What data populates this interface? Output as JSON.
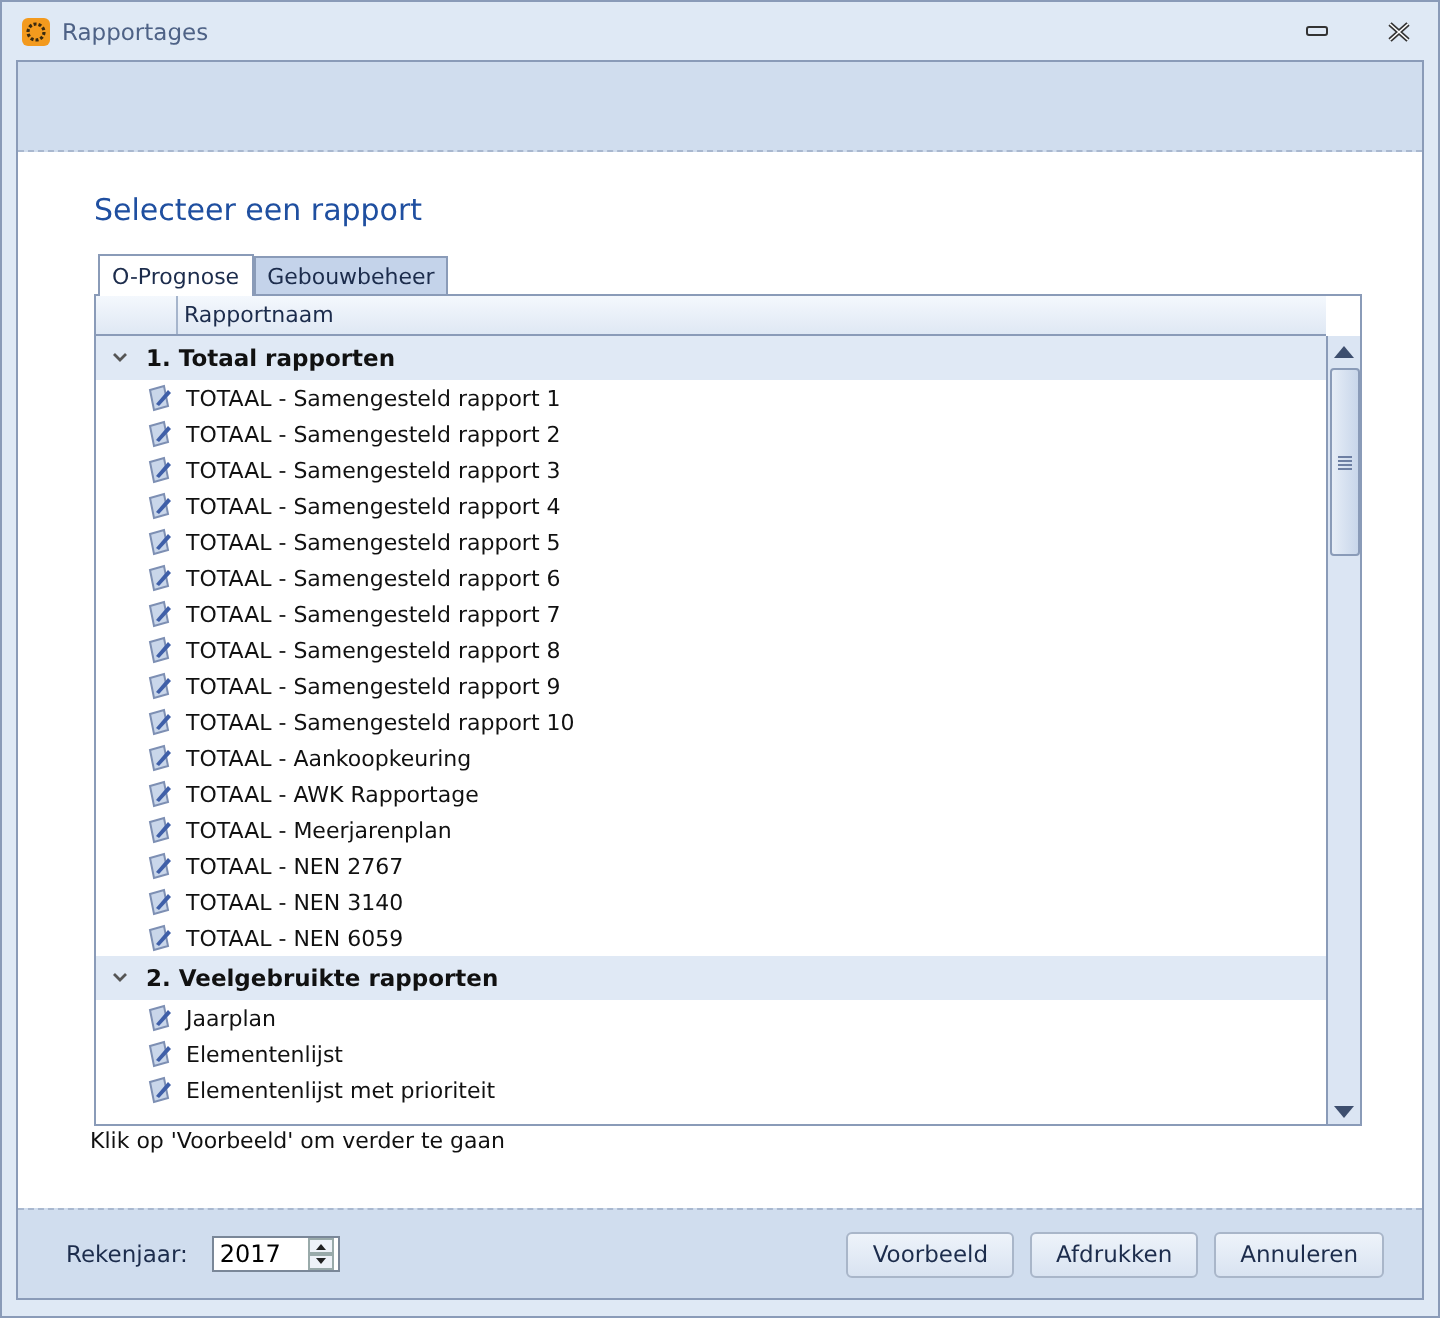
{
  "window": {
    "title": "Rapportages"
  },
  "heading": "Selecteer een rapport",
  "tabs": [
    {
      "label": "O-Prognose",
      "selected": true
    },
    {
      "label": "Gebouwbeheer",
      "selected": false
    }
  ],
  "table": {
    "columns": [
      "Rapportnaam"
    ],
    "groups": [
      {
        "label": "1. Totaal rapporten",
        "expanded": true,
        "children": [
          "TOTAAL - Samengesteld rapport 1",
          "TOTAAL - Samengesteld rapport 2",
          "TOTAAL - Samengesteld rapport 3",
          "TOTAAL - Samengesteld rapport 4",
          "TOTAAL - Samengesteld rapport 5",
          "TOTAAL - Samengesteld rapport 6",
          "TOTAAL - Samengesteld rapport 7",
          "TOTAAL - Samengesteld rapport 8",
          "TOTAAL - Samengesteld rapport 9",
          "TOTAAL - Samengesteld rapport 10",
          "TOTAAL - Aankoopkeuring",
          "TOTAAL - AWK Rapportage",
          "TOTAAL - Meerjarenplan",
          "TOTAAL - NEN 2767",
          "TOTAAL - NEN 3140",
          "TOTAAL - NEN 6059"
        ]
      },
      {
        "label": "2. Veelgebruikte rapporten",
        "expanded": true,
        "children": [
          "Jaarplan",
          "Elementenlijst",
          "Elementenlijst met prioriteit"
        ]
      }
    ]
  },
  "hint": "Klik op 'Voorbeeld' om verder te gaan",
  "year": {
    "label": "Rekenjaar:",
    "value": "2017"
  },
  "buttons": [
    "Voorbeeld",
    "Afdrukken",
    "Annuleren"
  ]
}
